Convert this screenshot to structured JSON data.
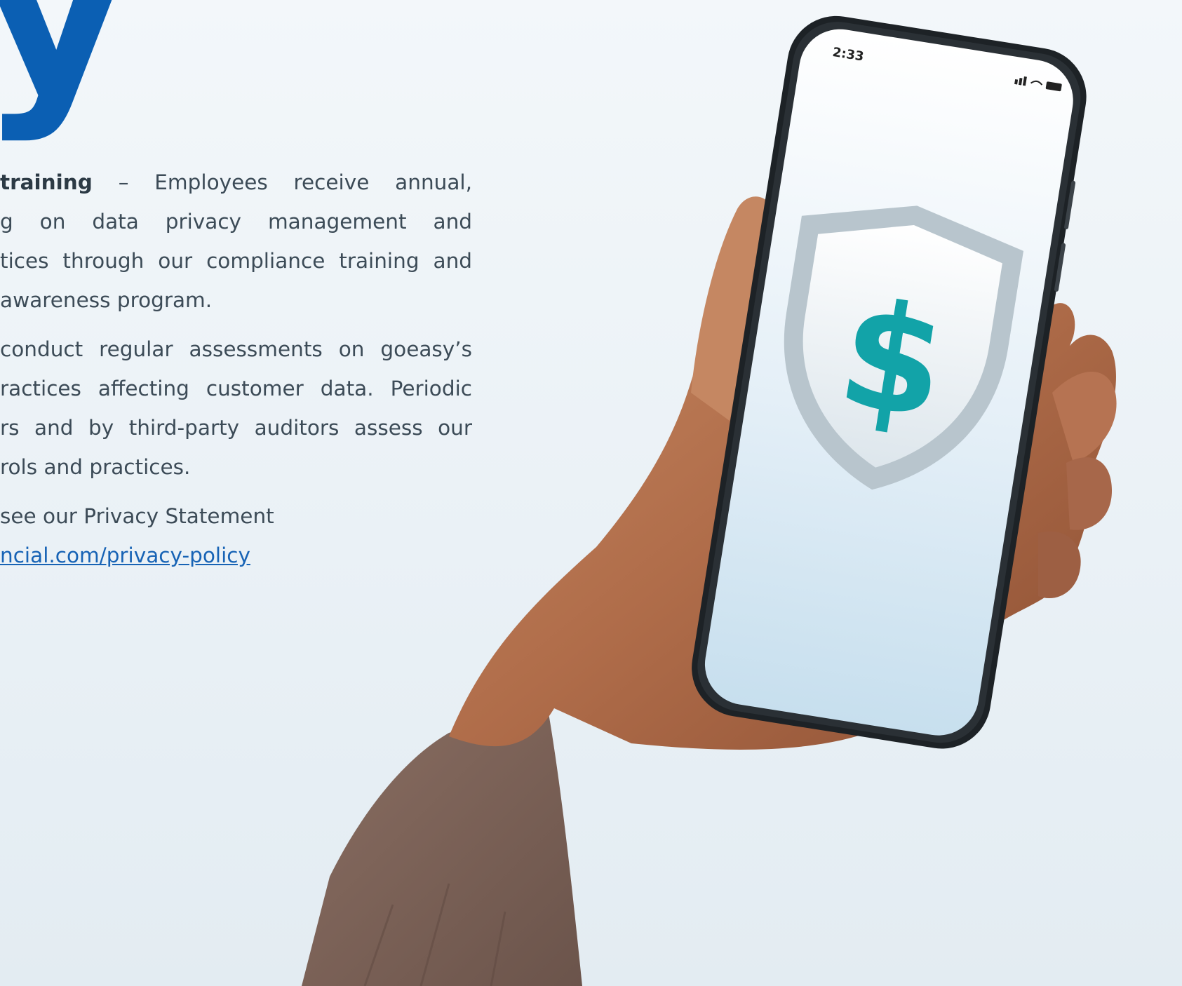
{
  "heading": {
    "fragment": "y"
  },
  "paragraphs": {
    "training": {
      "bold_lead": "training",
      "line1_rest": "– Employees receive annual,",
      "line2": "g on data privacy management and",
      "line3": "tices through our compliance training and",
      "line4": "awareness program."
    },
    "assessments": {
      "line1": "conduct regular assessments on goeasy’s",
      "line2": "ractices affecting customer data. Periodic",
      "line3": "rs and by third-party auditors assess our",
      "line4": "rols and practices."
    },
    "privacy": {
      "line1": "see our Privacy Statement",
      "link": "ncial.com/privacy-policy "
    }
  },
  "phone": {
    "status_time": "2:33",
    "screen_icon": "shield-dollar-icon"
  },
  "colors": {
    "brand_blue": "#0b5fb3",
    "body_text": "#3c4b57",
    "link": "#1763b5",
    "dollar_teal": "#12a3a8"
  }
}
